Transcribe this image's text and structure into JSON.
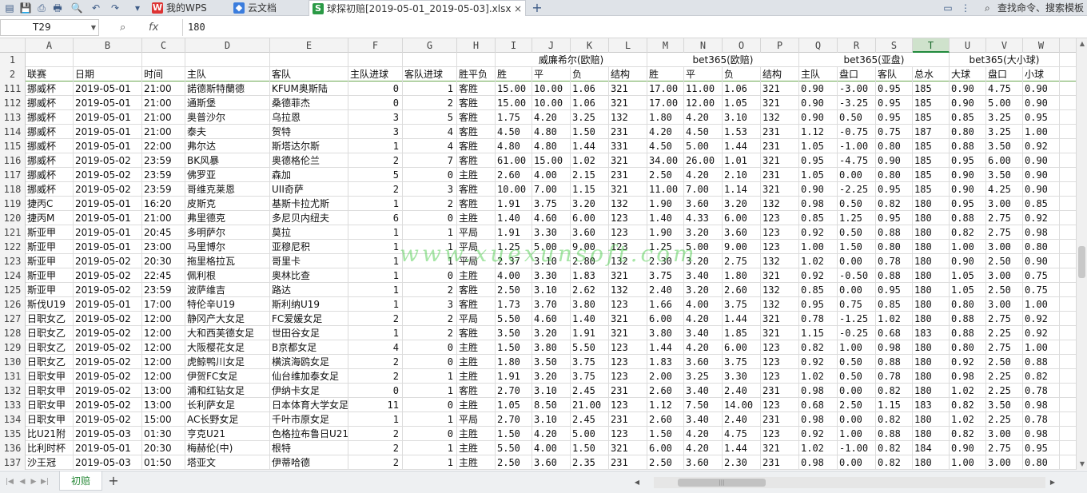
{
  "app": {
    "tabs": [
      {
        "label": "我的WPS",
        "icon": "wps-logo-icon"
      },
      {
        "label": "云文档",
        "icon": "cloud-doc-icon"
      },
      {
        "label": "球探初赔[2019-05-01_2019-05-03].xlsx",
        "icon": "spreadsheet-icon",
        "active": true
      }
    ],
    "search_label": "查找命令、搜索模板"
  },
  "formula": {
    "cell": "T29",
    "fx": "fx",
    "value": "180"
  },
  "columns": [
    "A",
    "B",
    "C",
    "D",
    "E",
    "F",
    "G",
    "H",
    "I",
    "J",
    "K",
    "L",
    "M",
    "N",
    "O",
    "P",
    "Q",
    "R",
    "S",
    "T",
    "U",
    "V",
    "W"
  ],
  "selected_column": "T",
  "header_row1": {
    "num": "1",
    "groups": [
      "威廉希尔(欧赔)",
      "bet365(欧赔)",
      "bet365(亚盘)",
      "bet365(大小球)"
    ]
  },
  "header_row2": {
    "num": "2",
    "cells": [
      "联赛",
      "日期",
      "时间",
      "主队",
      "客队",
      "主队进球",
      "客队进球",
      "胜平负",
      "胜",
      "平",
      "负",
      "结构",
      "胜",
      "平",
      "负",
      "结构",
      "主队",
      "盘口",
      "客队",
      "总水",
      "大球",
      "盘口",
      "小球"
    ]
  },
  "rows": [
    [
      "111",
      "挪威杯",
      "2019-05-01",
      "21:00",
      "諾德斯特蘭德",
      "KFUM奥斯陆",
      "0",
      "1",
      "客胜",
      "15.00",
      "10.00",
      "1.06",
      "321",
      "17.00",
      "11.00",
      "1.06",
      "321",
      "0.90",
      "-3.00",
      "0.95",
      "185",
      "0.90",
      "4.75",
      "0.90"
    ],
    [
      "112",
      "挪威杯",
      "2019-05-01",
      "21:00",
      "通斯堡",
      "桑德菲杰",
      "0",
      "2",
      "客胜",
      "15.00",
      "10.00",
      "1.06",
      "321",
      "17.00",
      "12.00",
      "1.05",
      "321",
      "0.90",
      "-3.25",
      "0.95",
      "185",
      "0.90",
      "5.00",
      "0.90"
    ],
    [
      "113",
      "挪威杯",
      "2019-05-01",
      "21:00",
      "奥普沙尔",
      "乌拉恩",
      "3",
      "5",
      "客胜",
      "1.75",
      "4.20",
      "3.25",
      "132",
      "1.80",
      "4.20",
      "3.10",
      "132",
      "0.90",
      "0.50",
      "0.95",
      "185",
      "0.85",
      "3.25",
      "0.95"
    ],
    [
      "114",
      "挪威杯",
      "2019-05-01",
      "21:00",
      "泰夫",
      "贺特",
      "3",
      "4",
      "客胜",
      "4.50",
      "4.80",
      "1.50",
      "231",
      "4.20",
      "4.50",
      "1.53",
      "231",
      "1.12",
      "-0.75",
      "0.75",
      "187",
      "0.80",
      "3.25",
      "1.00"
    ],
    [
      "115",
      "挪威杯",
      "2019-05-01",
      "22:00",
      "弗尔达",
      "斯塔达尔斯",
      "1",
      "4",
      "客胜",
      "4.80",
      "4.80",
      "1.44",
      "331",
      "4.50",
      "5.00",
      "1.44",
      "231",
      "1.05",
      "-1.00",
      "0.80",
      "185",
      "0.88",
      "3.50",
      "0.92"
    ],
    [
      "116",
      "挪威杯",
      "2019-05-02",
      "23:59",
      "BK风暴",
      "奥德格伦兰",
      "2",
      "7",
      "客胜",
      "61.00",
      "15.00",
      "1.02",
      "321",
      "34.00",
      "26.00",
      "1.01",
      "321",
      "0.95",
      "-4.75",
      "0.90",
      "185",
      "0.95",
      "6.00",
      "0.90"
    ],
    [
      "117",
      "挪威杯",
      "2019-05-02",
      "23:59",
      "佛罗亚",
      "森加",
      "5",
      "0",
      "主胜",
      "2.60",
      "4.00",
      "2.15",
      "231",
      "2.50",
      "4.20",
      "2.10",
      "231",
      "1.05",
      "0.00",
      "0.80",
      "185",
      "0.90",
      "3.50",
      "0.90"
    ],
    [
      "118",
      "挪威杯",
      "2019-05-02",
      "23:59",
      "哥维克莱恩",
      "UII奇萨",
      "2",
      "3",
      "客胜",
      "10.00",
      "7.00",
      "1.15",
      "321",
      "11.00",
      "7.00",
      "1.14",
      "321",
      "0.90",
      "-2.25",
      "0.95",
      "185",
      "0.90",
      "4.25",
      "0.90"
    ],
    [
      "119",
      "捷丙C",
      "2019-05-01",
      "16:20",
      "皮斯克",
      "基斯卡拉尤斯",
      "1",
      "2",
      "客胜",
      "1.91",
      "3.75",
      "3.20",
      "132",
      "1.90",
      "3.60",
      "3.20",
      "132",
      "0.98",
      "0.50",
      "0.82",
      "180",
      "0.95",
      "3.00",
      "0.85"
    ],
    [
      "120",
      "捷丙M",
      "2019-05-01",
      "21:00",
      "弗里德克",
      "多尼贝内纽夫",
      "6",
      "0",
      "主胜",
      "1.40",
      "4.60",
      "6.00",
      "123",
      "1.40",
      "4.33",
      "6.00",
      "123",
      "0.85",
      "1.25",
      "0.95",
      "180",
      "0.88",
      "2.75",
      "0.92"
    ],
    [
      "121",
      "斯亚甲",
      "2019-05-01",
      "20:45",
      "多明萨尔",
      "莫拉",
      "1",
      "1",
      "平局",
      "1.91",
      "3.30",
      "3.60",
      "123",
      "1.90",
      "3.20",
      "3.60",
      "123",
      "0.92",
      "0.50",
      "0.88",
      "180",
      "0.82",
      "2.75",
      "0.98"
    ],
    [
      "122",
      "斯亚甲",
      "2019-05-01",
      "23:00",
      "马里博尔",
      "亚穆尼积",
      "1",
      "1",
      "平局",
      "1.25",
      "5.00",
      "9.00",
      "123",
      "1.25",
      "5.00",
      "9.00",
      "123",
      "1.00",
      "1.50",
      "0.80",
      "180",
      "1.00",
      "3.00",
      "0.80"
    ],
    [
      "123",
      "斯亚甲",
      "2019-05-02",
      "20:30",
      "拖里格拉瓦",
      "哥里卡",
      "1",
      "1",
      "平局",
      "2.37",
      "3.10",
      "2.80",
      "132",
      "2.30",
      "3.20",
      "2.75",
      "132",
      "1.02",
      "0.00",
      "0.78",
      "180",
      "0.90",
      "2.50",
      "0.90"
    ],
    [
      "124",
      "斯亚甲",
      "2019-05-02",
      "22:45",
      "佩利根",
      "奥林比查",
      "1",
      "0",
      "主胜",
      "4.00",
      "3.30",
      "1.83",
      "321",
      "3.75",
      "3.40",
      "1.80",
      "321",
      "0.92",
      "-0.50",
      "0.88",
      "180",
      "1.05",
      "3.00",
      "0.75"
    ],
    [
      "125",
      "斯亚甲",
      "2019-05-02",
      "23:59",
      "波萨维吉",
      "路达",
      "1",
      "2",
      "客胜",
      "2.50",
      "3.10",
      "2.62",
      "132",
      "2.40",
      "3.20",
      "2.60",
      "132",
      "0.85",
      "0.00",
      "0.95",
      "180",
      "1.05",
      "2.50",
      "0.75"
    ],
    [
      "126",
      "斯伐U19",
      "2019-05-01",
      "17:00",
      "特伦辛U19",
      "斯利纳U19",
      "1",
      "3",
      "客胜",
      "1.73",
      "3.70",
      "3.80",
      "123",
      "1.66",
      "4.00",
      "3.75",
      "132",
      "0.95",
      "0.75",
      "0.85",
      "180",
      "0.80",
      "3.00",
      "1.00"
    ],
    [
      "127",
      "日职女乙",
      "2019-05-02",
      "12:00",
      "静冈产大女足",
      "FC爱媛女足",
      "2",
      "2",
      "平局",
      "5.50",
      "4.60",
      "1.40",
      "321",
      "6.00",
      "4.20",
      "1.44",
      "321",
      "0.78",
      "-1.25",
      "1.02",
      "180",
      "0.88",
      "2.75",
      "0.92"
    ],
    [
      "128",
      "日职女乙",
      "2019-05-02",
      "12:00",
      "大和西芙德女足",
      "世田谷女足",
      "1",
      "2",
      "客胜",
      "3.50",
      "3.20",
      "1.91",
      "321",
      "3.80",
      "3.40",
      "1.85",
      "321",
      "1.15",
      "-0.25",
      "0.68",
      "183",
      "0.88",
      "2.25",
      "0.92"
    ],
    [
      "129",
      "日职女乙",
      "2019-05-02",
      "12:00",
      "大阪樱花女足",
      "B京都女足",
      "4",
      "0",
      "主胜",
      "1.50",
      "3.80",
      "5.50",
      "123",
      "1.44",
      "4.20",
      "6.00",
      "123",
      "0.82",
      "1.00",
      "0.98",
      "180",
      "0.80",
      "2.75",
      "1.00"
    ],
    [
      "130",
      "日职女乙",
      "2019-05-02",
      "12:00",
      "虎鲸鸭川女足",
      "横滨海鸥女足",
      "2",
      "0",
      "主胜",
      "1.80",
      "3.50",
      "3.75",
      "123",
      "1.83",
      "3.60",
      "3.75",
      "123",
      "0.92",
      "0.50",
      "0.88",
      "180",
      "0.92",
      "2.50",
      "0.88"
    ],
    [
      "131",
      "日职女甲",
      "2019-05-02",
      "12:00",
      "伊贺FC女足",
      "仙台维加泰女足",
      "2",
      "1",
      "主胜",
      "1.91",
      "3.20",
      "3.75",
      "123",
      "2.00",
      "3.25",
      "3.30",
      "123",
      "1.02",
      "0.50",
      "0.78",
      "180",
      "0.98",
      "2.25",
      "0.82"
    ],
    [
      "132",
      "日职女甲",
      "2019-05-02",
      "13:00",
      "浦和红钻女足",
      "伊纳卡女足",
      "0",
      "1",
      "客胜",
      "2.70",
      "3.10",
      "2.45",
      "231",
      "2.60",
      "3.40",
      "2.40",
      "231",
      "0.98",
      "0.00",
      "0.82",
      "180",
      "1.02",
      "2.25",
      "0.78"
    ],
    [
      "133",
      "日职女甲",
      "2019-05-02",
      "13:00",
      "长利萨女足",
      "日本体育大学女足",
      "11",
      "0",
      "主胜",
      "1.05",
      "8.50",
      "21.00",
      "123",
      "1.12",
      "7.50",
      "14.00",
      "123",
      "0.68",
      "2.50",
      "1.15",
      "183",
      "0.82",
      "3.50",
      "0.98"
    ],
    [
      "134",
      "日职女甲",
      "2019-05-02",
      "15:00",
      "AC长野女足",
      "千叶市原女足",
      "1",
      "1",
      "平局",
      "2.70",
      "3.10",
      "2.45",
      "231",
      "2.60",
      "3.40",
      "2.40",
      "231",
      "0.98",
      "0.00",
      "0.82",
      "180",
      "1.02",
      "2.25",
      "0.78"
    ],
    [
      "135",
      "比U21附",
      "2019-05-03",
      "01:30",
      "亨克U21",
      "色格拉布鲁日U21",
      "2",
      "0",
      "主胜",
      "1.50",
      "4.20",
      "5.00",
      "123",
      "1.50",
      "4.20",
      "4.75",
      "123",
      "0.92",
      "1.00",
      "0.88",
      "180",
      "0.82",
      "3.00",
      "0.98"
    ],
    [
      "136",
      "比利时杯",
      "2019-05-01",
      "20:30",
      "梅赫伦(中)",
      "根特",
      "2",
      "1",
      "主胜",
      "5.50",
      "4.00",
      "1.50",
      "321",
      "6.00",
      "4.20",
      "1.44",
      "321",
      "1.02",
      "-1.00",
      "0.82",
      "184",
      "0.90",
      "2.75",
      "0.95"
    ],
    [
      "137",
      "沙王冠",
      "2019-05-03",
      "01:50",
      "塔亚文",
      "伊蒂哈德",
      "2",
      "1",
      "主胜",
      "2.50",
      "3.60",
      "2.35",
      "231",
      "2.50",
      "3.60",
      "2.30",
      "231",
      "0.98",
      "0.00",
      "0.82",
      "180",
      "1.00",
      "3.00",
      "0.80"
    ]
  ],
  "watermark": "www.xuexunsoft.com",
  "sheet": {
    "name": "初赔"
  }
}
